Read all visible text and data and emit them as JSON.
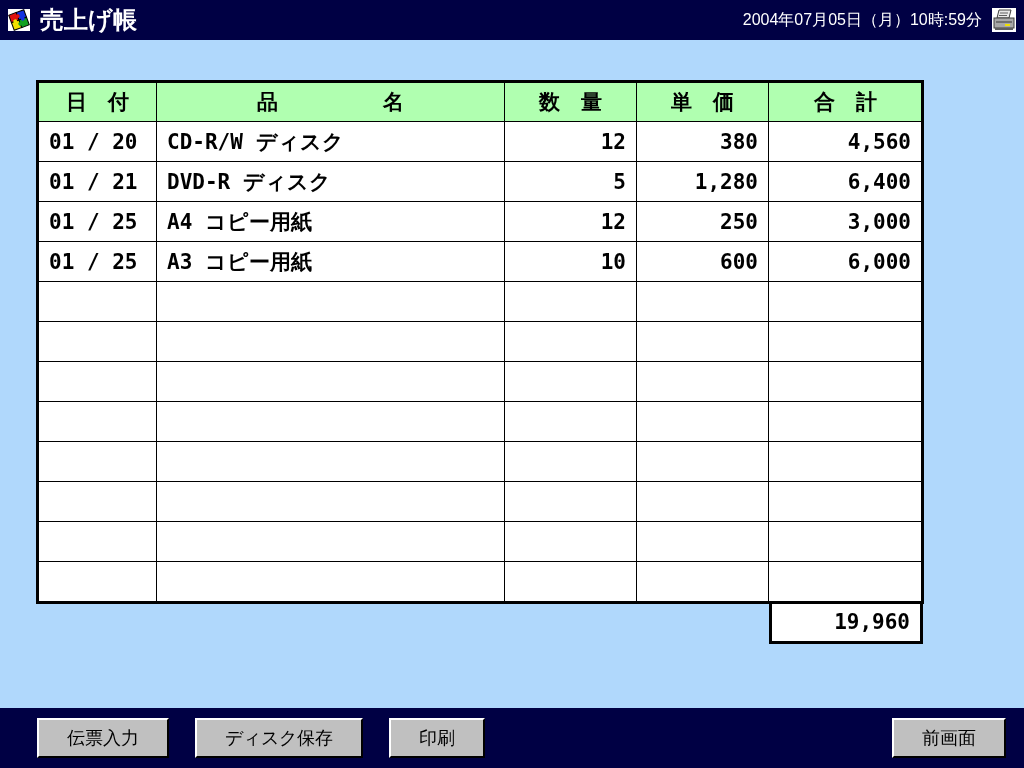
{
  "window": {
    "title": "売上げ帳",
    "datetime": "2004年07月05日（月）10時:59分"
  },
  "table": {
    "columns": [
      "日　付",
      "品　　　　　名",
      "数　量",
      "単　価",
      "合　計"
    ],
    "rows": [
      {
        "kind": "entry",
        "date": "01 / 20",
        "item": "CD-R/W ディスク",
        "quantity": "12",
        "unit_price": "380",
        "amount": "4,560"
      },
      {
        "kind": "entry",
        "date": "01 / 21",
        "item": "DVD-R ディスク",
        "quantity": "5",
        "unit_price": "1,280",
        "amount": "6,400"
      },
      {
        "kind": "entry",
        "date": "01 / 25",
        "item": "A4 コピー用紙",
        "quantity": "12",
        "unit_price": "250",
        "amount": "3,000"
      },
      {
        "kind": "entry",
        "date": "01 / 25",
        "item": "A3 コピー用紙",
        "quantity": "10",
        "unit_price": "600",
        "amount": "6,000"
      },
      {
        "kind": "blank"
      },
      {
        "kind": "blank"
      },
      {
        "kind": "blank"
      },
      {
        "kind": "blank"
      },
      {
        "kind": "blank"
      },
      {
        "kind": "blank"
      },
      {
        "kind": "blank"
      },
      {
        "kind": "blank"
      }
    ],
    "total": "19,960"
  },
  "footer": {
    "left_buttons": [
      "伝票入力",
      "ディスク保存",
      "印刷"
    ],
    "right_buttons": [
      "前画面"
    ]
  }
}
